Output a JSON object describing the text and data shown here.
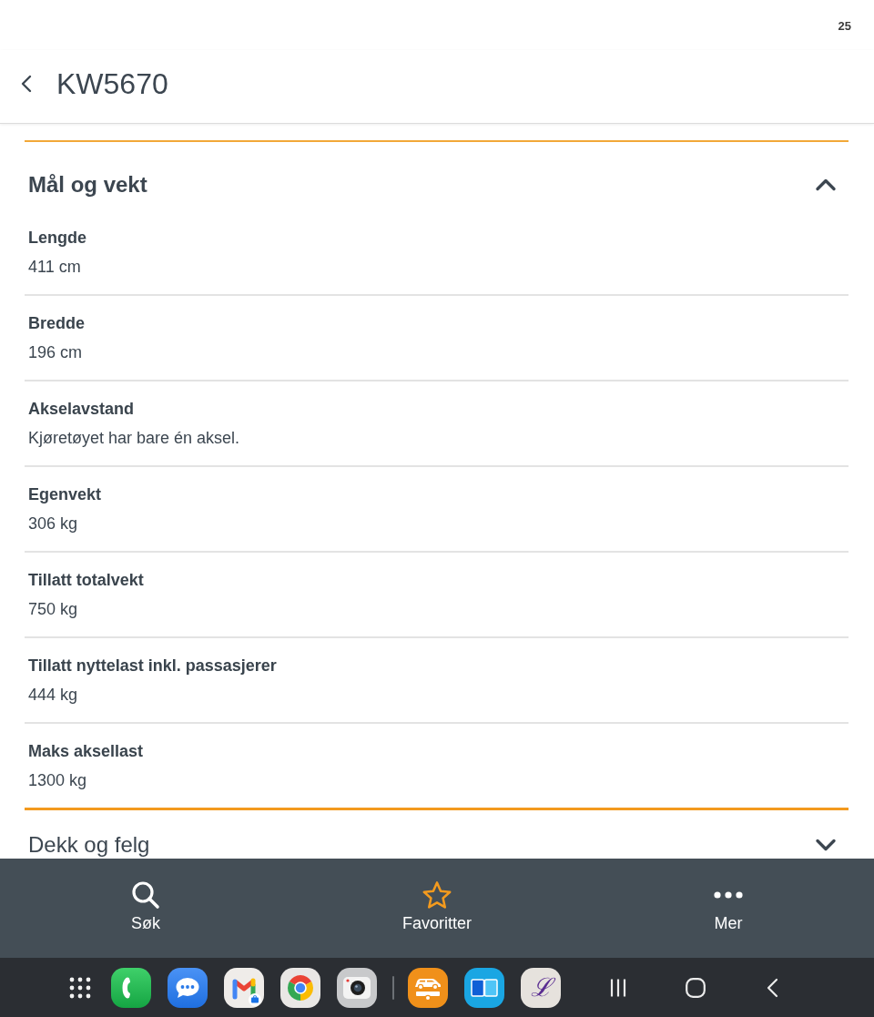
{
  "status_bar": {
    "text": "25"
  },
  "header": {
    "title": "KW5670"
  },
  "sections": [
    {
      "title": "Mål og vekt",
      "expanded": true,
      "fields": [
        {
          "label": "Lengde",
          "value": "411 cm"
        },
        {
          "label": "Bredde",
          "value": "196 cm"
        },
        {
          "label": "Akselavstand",
          "value": "Kjøretøyet har bare én aksel."
        },
        {
          "label": "Egenvekt",
          "value": "306 kg"
        },
        {
          "label": "Tillatt totalvekt",
          "value": "750 kg"
        },
        {
          "label": "Tillatt nyttelast inkl. passasjerer",
          "value": "444 kg"
        },
        {
          "label": "Maks aksellast",
          "value": "1300 kg"
        }
      ]
    },
    {
      "title": "Dekk og felg",
      "expanded": false
    }
  ],
  "bottom_nav": [
    {
      "kind": "search",
      "label": "Søk"
    },
    {
      "kind": "favorites",
      "label": "Favoritter"
    },
    {
      "kind": "more",
      "label": "Mer"
    }
  ],
  "system_bar": {
    "apps": [
      {
        "kind": "apps"
      },
      {
        "kind": "phone"
      },
      {
        "kind": "messages"
      },
      {
        "kind": "mail"
      },
      {
        "kind": "browser"
      },
      {
        "kind": "camera"
      },
      {
        "kind": "divider"
      },
      {
        "kind": "vehicle"
      },
      {
        "kind": "reader"
      },
      {
        "kind": "letter",
        "glyph": "ℒ"
      }
    ],
    "nav": [
      {
        "kind": "recents"
      },
      {
        "kind": "home"
      },
      {
        "kind": "back"
      }
    ]
  }
}
